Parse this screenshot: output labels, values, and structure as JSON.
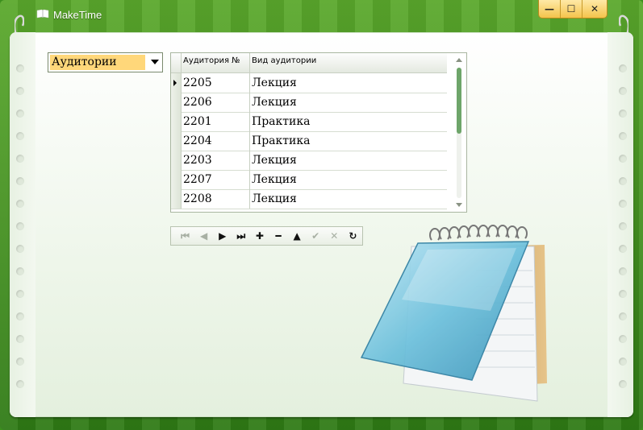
{
  "window": {
    "title": "MakeTime",
    "buttons": {
      "minimize": "—",
      "maximize": "☐",
      "close": "✕"
    }
  },
  "dropdown": {
    "selected": "Аудитории"
  },
  "grid": {
    "columns": [
      "Аудитория №",
      "Вид аудитории"
    ],
    "rows": [
      [
        "2205",
        "Лекция"
      ],
      [
        "2206",
        "Лекция"
      ],
      [
        "2201",
        "Практика"
      ],
      [
        "2204",
        "Практика"
      ],
      [
        "2203",
        "Лекция"
      ],
      [
        "2207",
        "Лекция"
      ],
      [
        "2208",
        "Лекция"
      ]
    ],
    "current_row": 0
  },
  "navigator": {
    "buttons": [
      {
        "name": "first-record-icon",
        "glyph": "⏮",
        "enabled": false
      },
      {
        "name": "prev-record-icon",
        "glyph": "◀",
        "enabled": false
      },
      {
        "name": "next-record-icon",
        "glyph": "▶",
        "enabled": true
      },
      {
        "name": "last-record-icon",
        "glyph": "⏭",
        "enabled": true
      },
      {
        "name": "insert-record-icon",
        "glyph": "✚",
        "enabled": true
      },
      {
        "name": "delete-record-icon",
        "glyph": "━",
        "enabled": true
      },
      {
        "name": "edit-record-icon",
        "glyph": "▲",
        "enabled": true
      },
      {
        "name": "post-record-icon",
        "glyph": "✔",
        "enabled": false
      },
      {
        "name": "cancel-record-icon",
        "glyph": "✕",
        "enabled": false
      },
      {
        "name": "refresh-icon",
        "glyph": "↻",
        "enabled": true
      }
    ]
  },
  "colors": {
    "accent": "#ffd77a",
    "frame": "#3c8f1e",
    "scroll_thumb": "#6ea56a"
  }
}
